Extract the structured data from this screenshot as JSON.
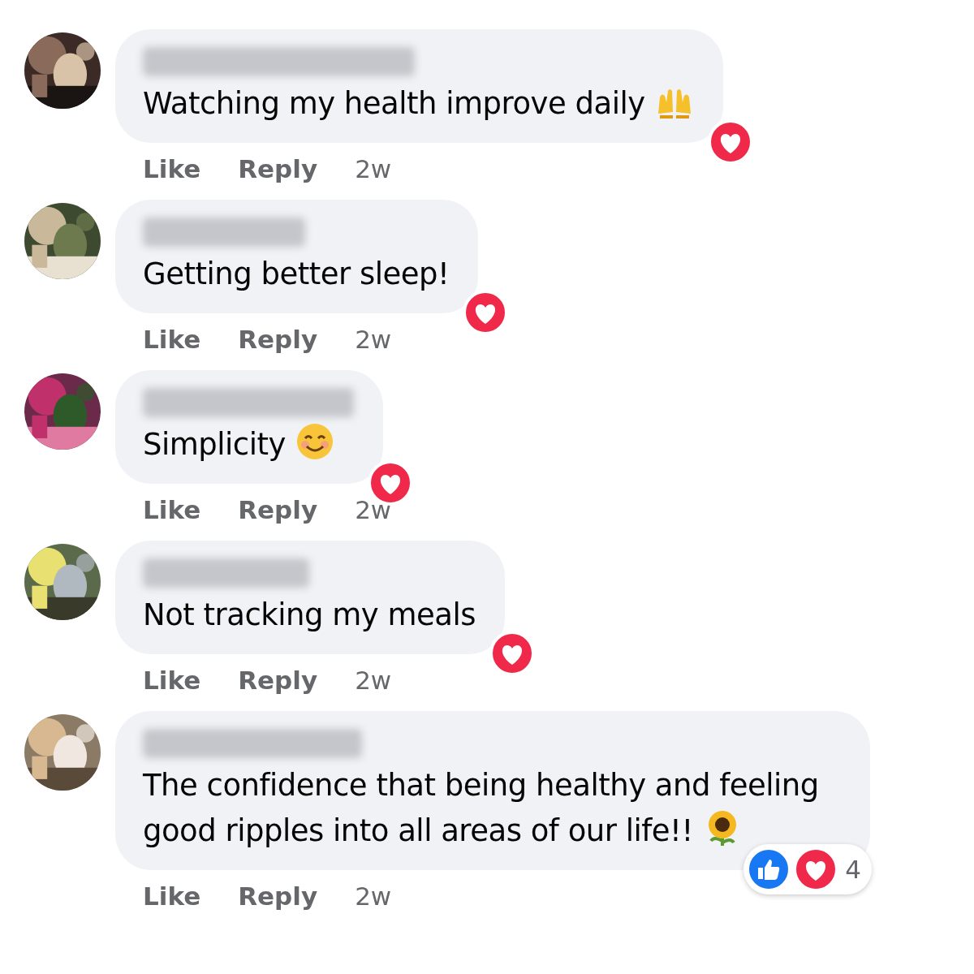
{
  "comments": [
    {
      "text": "Watching my health improve daily",
      "emoji": {
        "kind": "hands"
      },
      "reactions": [
        {
          "kind": "love"
        }
      ],
      "actions": [
        "Like",
        "Reply"
      ],
      "time": "2w"
    },
    {
      "text": "Getting better sleep!",
      "reactions": [
        {
          "kind": "love"
        }
      ],
      "actions": [
        "Like",
        "Reply"
      ],
      "time": "2w"
    },
    {
      "text": "Simplicity",
      "emoji": {
        "kind": "smile"
      },
      "reactions": [
        {
          "kind": "love"
        }
      ],
      "actions": [
        "Like",
        "Reply"
      ],
      "time": "2w"
    },
    {
      "text": "Not tracking my meals",
      "reactions": [
        {
          "kind": "love"
        }
      ],
      "actions": [
        "Like",
        "Reply"
      ],
      "time": "2w"
    },
    {
      "text": "The confidence that being healthy and feeling good ripples into all areas of our life!!",
      "emoji": {
        "kind": "sunflower"
      },
      "reactions": [
        {
          "kind": "like"
        },
        {
          "kind": "love"
        }
      ],
      "reaction_count": "4",
      "actions": [
        "Like",
        "Reply"
      ],
      "time": "2w"
    }
  ]
}
